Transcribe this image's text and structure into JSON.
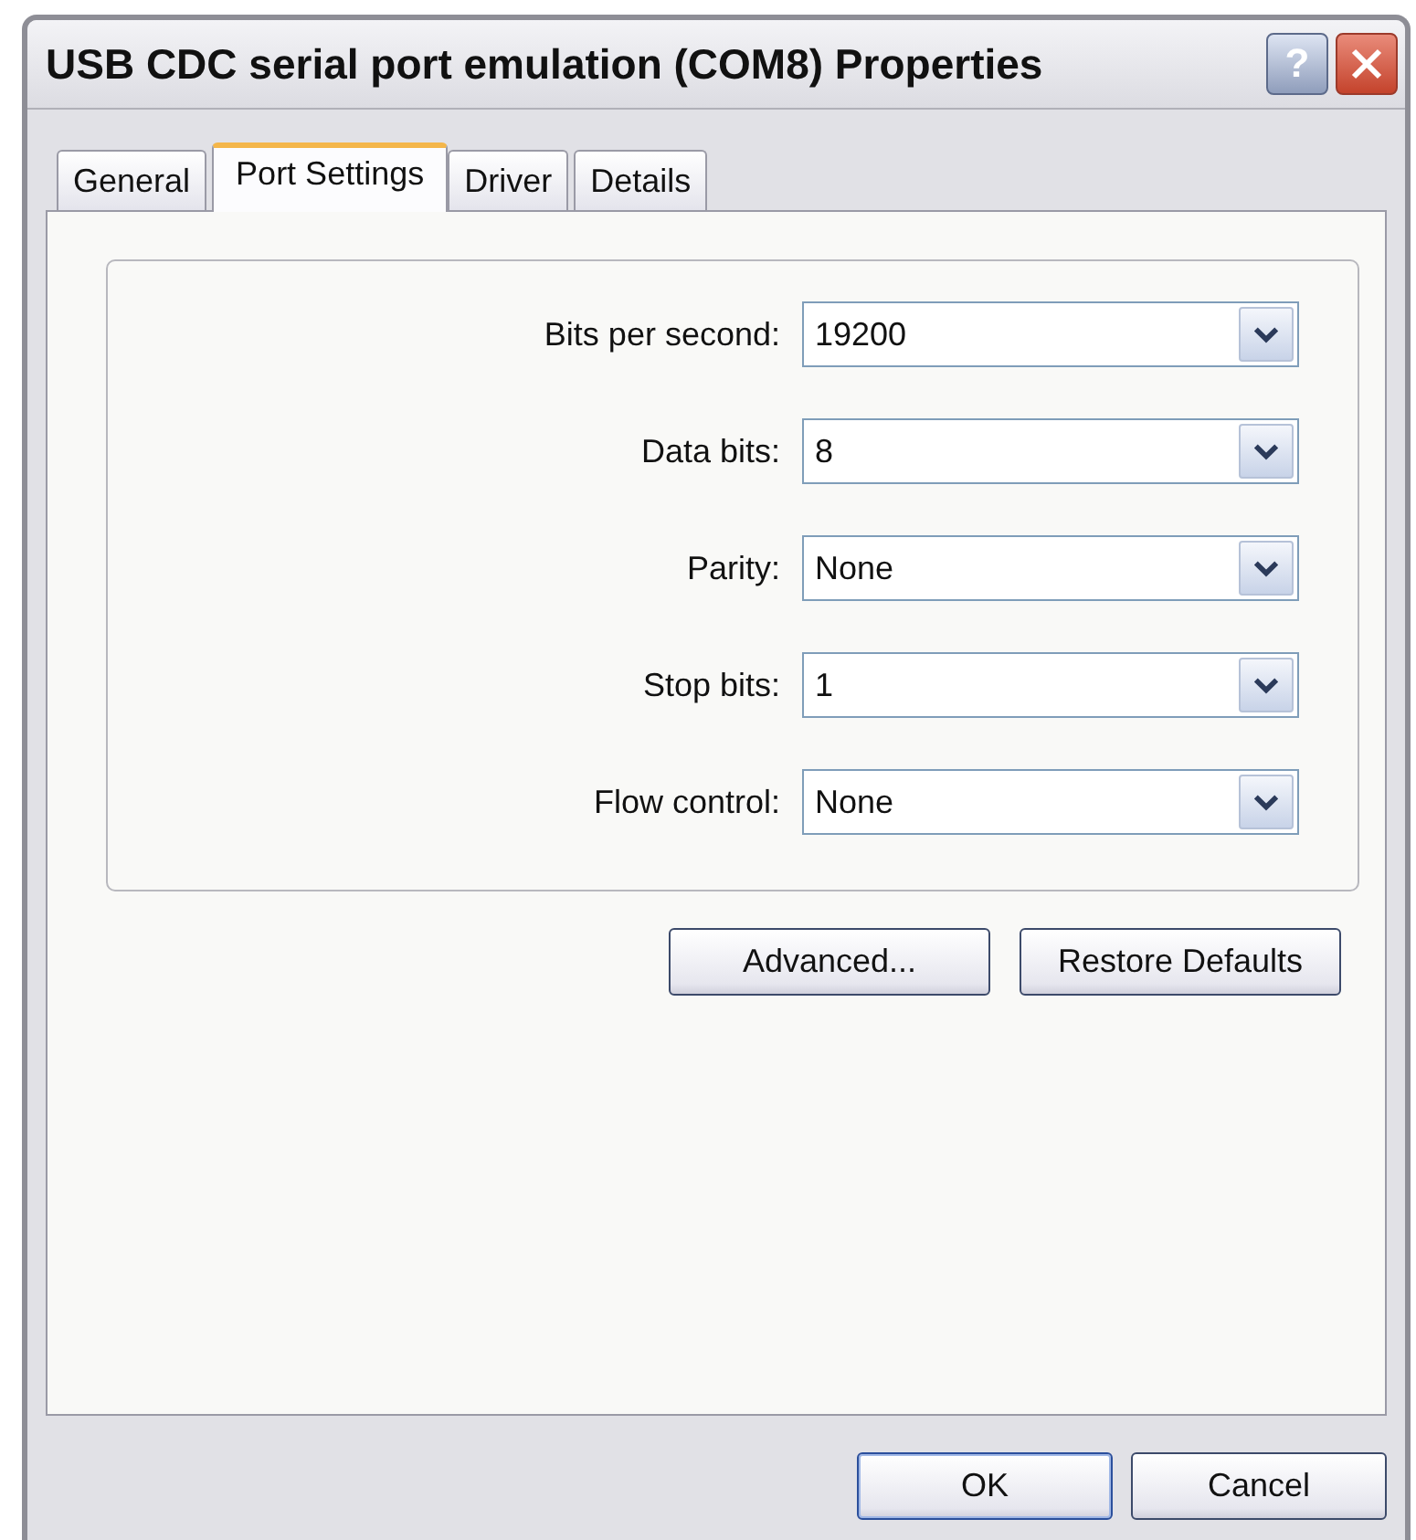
{
  "window": {
    "title": "USB CDC serial port emulation (COM8) Properties",
    "title_buttons": [
      {
        "kind": "help",
        "label": "?"
      },
      {
        "kind": "close"
      }
    ]
  },
  "tabs": [
    {
      "label": "General",
      "selected": false
    },
    {
      "label": "Port Settings",
      "selected": true
    },
    {
      "label": "Driver",
      "selected": false
    },
    {
      "label": "Details",
      "selected": false
    }
  ],
  "settings": [
    {
      "label": "Bits per second:",
      "value": "19200"
    },
    {
      "label": "Data bits:",
      "value": "8"
    },
    {
      "label": "Parity:",
      "value": "None"
    },
    {
      "label": "Stop bits:",
      "value": "1"
    },
    {
      "label": "Flow control:",
      "value": "None"
    }
  ],
  "panel_buttons": [
    "Advanced...",
    "Restore Defaults"
  ],
  "dialog_buttons": [
    {
      "label": "OK",
      "default": true
    },
    {
      "label": "Cancel",
      "default": false
    }
  ]
}
